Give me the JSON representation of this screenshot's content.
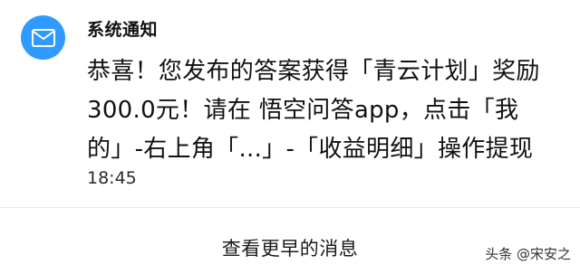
{
  "notification": {
    "icon": "mail-icon",
    "accent_color": "#2f9bff",
    "sender": "系统通知",
    "message_lines": [
      "恭喜！您发布的答案获得「青云计划」奖励",
      "300.0元！请在 悟空问答app，点击「我",
      "的」-右上角「...」-「收益明细」操作提现"
    ],
    "time": "18:45"
  },
  "footer": {
    "more_link": "查看更早的消息"
  },
  "watermark": {
    "text": "头条 @宋安之"
  }
}
